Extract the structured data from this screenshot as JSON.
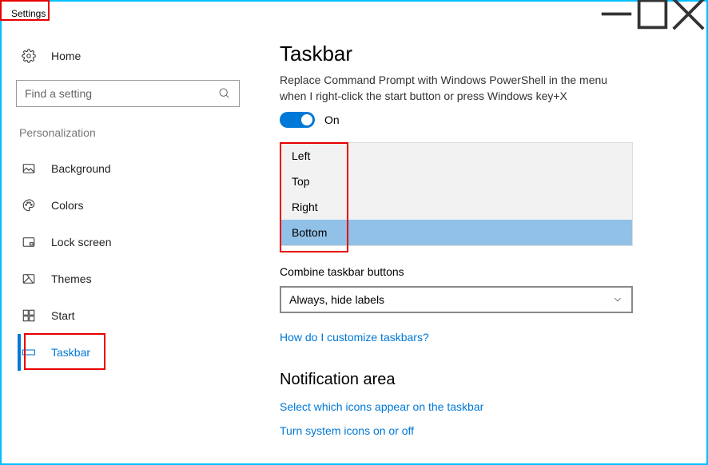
{
  "window": {
    "title": "Settings"
  },
  "sidebar": {
    "home": "Home",
    "search_placeholder": "Find a setting",
    "section": "Personalization",
    "items": [
      {
        "label": "Background"
      },
      {
        "label": "Colors"
      },
      {
        "label": "Lock screen"
      },
      {
        "label": "Themes"
      },
      {
        "label": "Start"
      },
      {
        "label": "Taskbar"
      }
    ]
  },
  "main": {
    "title": "Taskbar",
    "powershell_desc_line1": "Replace Command Prompt with Windows PowerShell in the menu",
    "powershell_desc_line2": "when I right-click the start button or press Windows key+X",
    "toggle_label": "On",
    "position_options": [
      "Left",
      "Top",
      "Right",
      "Bottom"
    ],
    "position_selected": "Bottom",
    "combine_label": "Combine taskbar buttons",
    "combine_value": "Always, hide labels",
    "customize_link": "How do I customize taskbars?",
    "notif_heading": "Notification area",
    "notif_link1": "Select which icons appear on the taskbar",
    "notif_link2": "Turn system icons on or off"
  }
}
